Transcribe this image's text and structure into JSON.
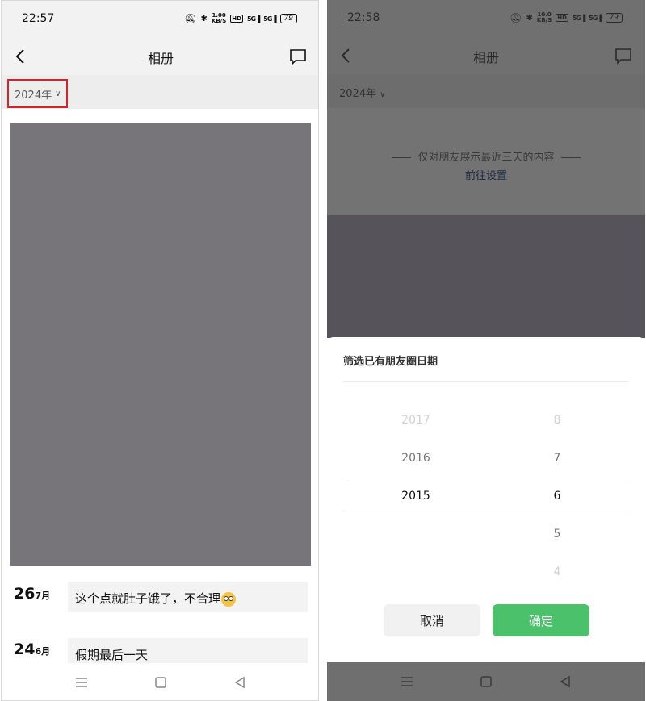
{
  "left": {
    "status": {
      "time": "22:57",
      "speed": "1.00",
      "speed_unit": "KB/S",
      "hd": "HD",
      "sig1": "5G",
      "sig2": "5G",
      "battery": "79"
    },
    "nav": {
      "title": "相册"
    },
    "year_filter": {
      "label": "2024年"
    },
    "posts": [
      {
        "day": "26",
        "month": "7月",
        "text": "这个点就肚子饿了，不合理"
      },
      {
        "day": "24",
        "month": "6月",
        "text": "假期最后一天"
      }
    ]
  },
  "right": {
    "status": {
      "time": "22:58",
      "speed": "10.0",
      "speed_unit": "KB/S",
      "hd": "HD",
      "sig1": "5G",
      "sig2": "5G",
      "battery": "79"
    },
    "nav": {
      "title": "相册"
    },
    "year_filter": {
      "label": "2024年"
    },
    "notice": {
      "text": "仅对朋友展示最近三天的内容",
      "link": "前往设置"
    },
    "sheet": {
      "title": "筛选已有朋友圈日期",
      "years": [
        "2017",
        "2016",
        "2015"
      ],
      "months": [
        "8",
        "7",
        "6",
        "5",
        "4"
      ],
      "selected_year": "2015",
      "selected_month": "6",
      "cancel": "取消",
      "confirm": "确定"
    }
  },
  "colors": {
    "accent": "#4bc16b",
    "highlight_border": "#d6232a",
    "photo_placeholder": "#77757a"
  }
}
